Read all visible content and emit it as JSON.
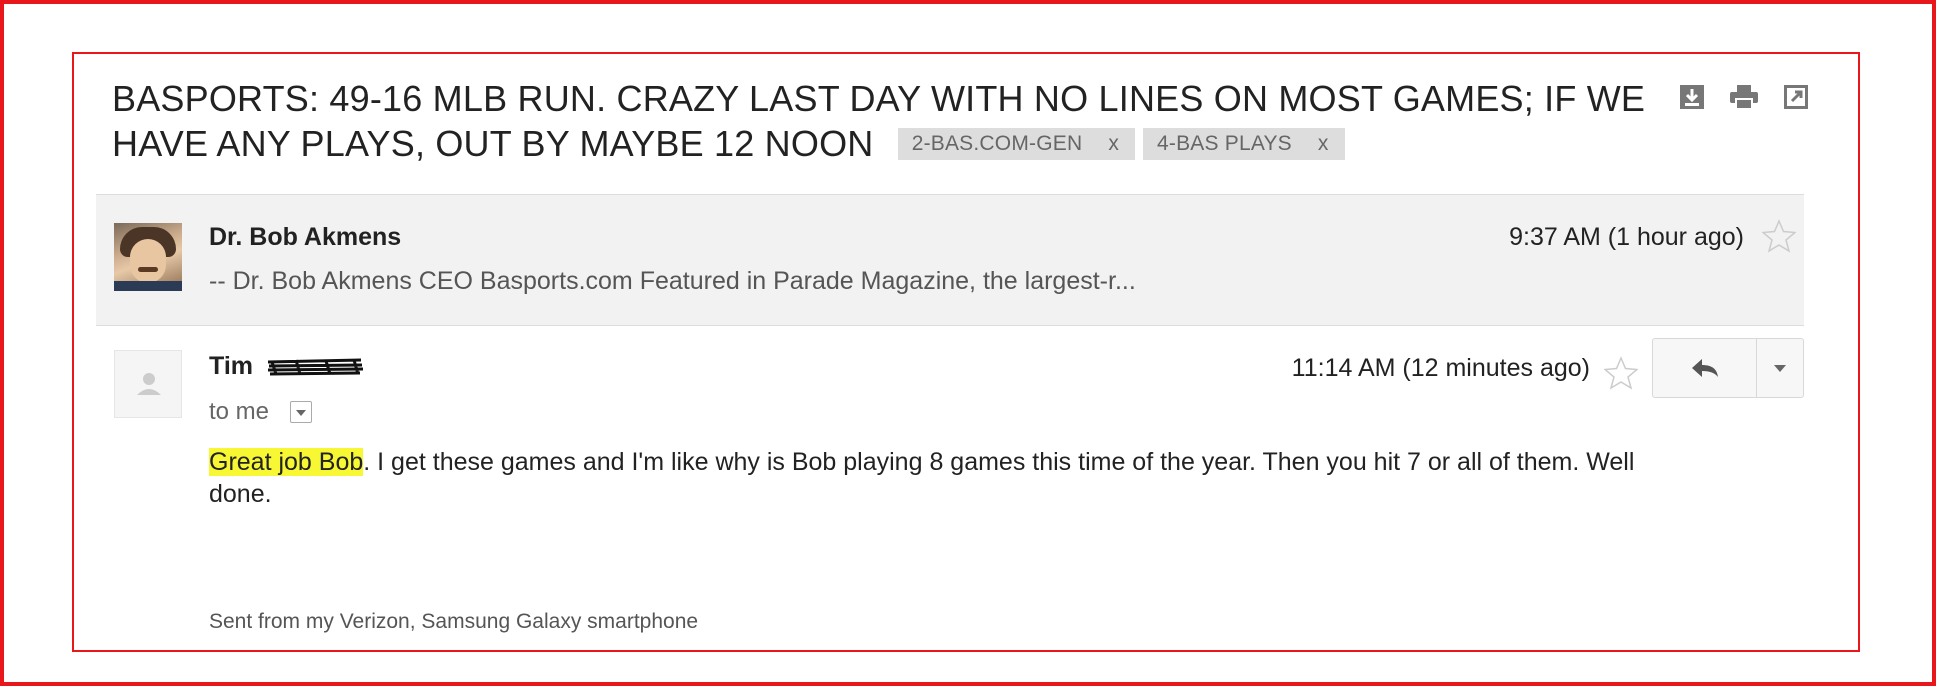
{
  "email": {
    "subject": "BASPORTS: 49-16 MLB RUN. CRAZY LAST DAY WITH NO LINES ON MOST GAMES; IF WE HAVE ANY PLAYS, OUT BY MAYBE 12 NOON",
    "labels": [
      {
        "text": "2-BAS.COM-GEN",
        "remove": "x"
      },
      {
        "text": "4-BAS PLAYS",
        "remove": "x"
      }
    ],
    "actions": [
      "download-icon",
      "print-icon",
      "new-window-icon"
    ],
    "messages": [
      {
        "sender": "Dr. Bob Akmens",
        "snippet": "-- Dr. Bob Akmens CEO Basports.com Featured in Parade Magazine, the largest-r...",
        "time": "9:37 AM (1 hour ago)"
      },
      {
        "sender": "Tim",
        "recipient": "to me",
        "time": "11:14 AM (12 minutes ago)",
        "body_highlight": "Great job Bob",
        "body_rest": ". I get these games and I'm like why is Bob playing 8 games this time of the year. Then you hit 7 or all of them. Well done.",
        "signature": "Sent from my Verizon, Samsung Galaxy smartphone"
      }
    ]
  },
  "colors": {
    "frame": "#e8171c",
    "highlight": "#f7f734",
    "collapsed_bg": "#f2f2f2",
    "label_bg": "#dddddd"
  }
}
